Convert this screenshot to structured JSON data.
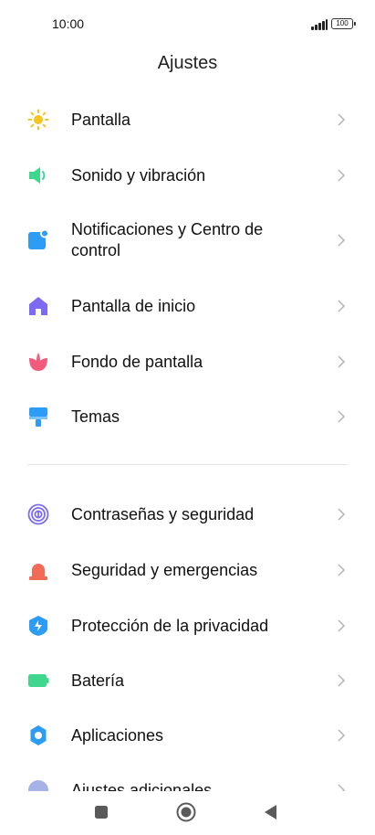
{
  "status": {
    "time": "10:00",
    "battery": "100"
  },
  "header": {
    "title": "Ajustes"
  },
  "sections": [
    {
      "items": [
        {
          "label": "Pantalla",
          "icon": "sun-icon",
          "color": "#F7C31E"
        },
        {
          "label": "Sonido y vibración",
          "icon": "speaker-icon",
          "color": "#3FD68E"
        },
        {
          "label": "Notificaciones y Centro de control",
          "icon": "notification-icon",
          "color": "#2D9CF5"
        },
        {
          "label": "Pantalla de inicio",
          "icon": "home-icon",
          "color": "#7A6BF2"
        },
        {
          "label": "Fondo de pantalla",
          "icon": "flower-icon",
          "color": "#F25B7C"
        },
        {
          "label": "Temas",
          "icon": "paint-brush-icon",
          "color": "#2D9CF5"
        }
      ]
    },
    {
      "items": [
        {
          "label": "Contraseñas y seguridad",
          "icon": "fingerprint-icon",
          "color": "#7A6BF2"
        },
        {
          "label": "Seguridad y emergencias",
          "icon": "alarm-icon",
          "color": "#F26B55"
        },
        {
          "label": "Protección de la privacidad",
          "icon": "shield-icon",
          "color": "#2D9CF5"
        },
        {
          "label": "Batería",
          "icon": "battery-icon",
          "color": "#3FD68E"
        },
        {
          "label": "Aplicaciones",
          "icon": "gear-icon",
          "color": "#2D9CF5"
        },
        {
          "label": "Ajustes adicionales",
          "icon": "more-settings-icon",
          "color": "#A7B2E6"
        }
      ]
    }
  ],
  "navigation": {
    "buttons": [
      "recents-icon",
      "home-button-icon",
      "back-icon"
    ]
  }
}
